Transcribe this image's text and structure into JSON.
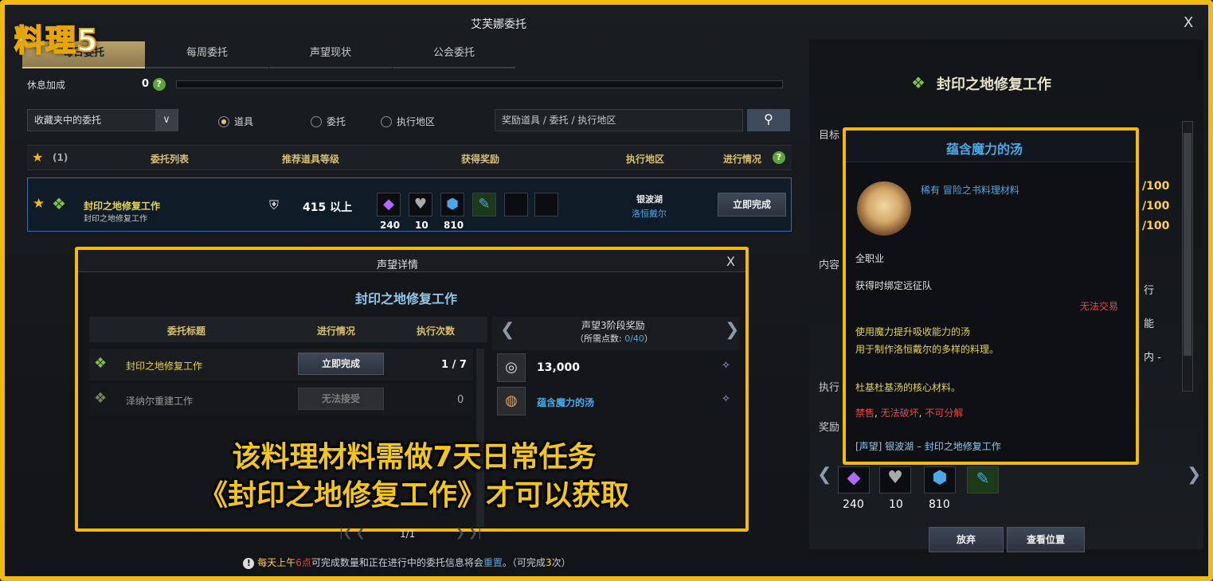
{
  "overlay_tag": "料理5",
  "window": {
    "title": "艾芙娜委托",
    "close_glyph": "X"
  },
  "tabs": [
    {
      "label": "每日委托",
      "active": true
    },
    {
      "label": "每周委托",
      "active": false
    },
    {
      "label": "声望现状",
      "active": false
    },
    {
      "label": "公会委托",
      "active": false
    }
  ],
  "rest": {
    "label": "休息加成",
    "value": "0",
    "help": "?"
  },
  "filter": {
    "dropdown_value": "收藏夹中的委托",
    "radio_item": "道具",
    "radio_task": "委托",
    "radio_area": "执行地区",
    "search_placeholder": "奖励道具 / 委托 / 执行地区"
  },
  "table_header": {
    "fav_count": "(1)",
    "list": "委托列表",
    "level": "推荐道具等级",
    "reward": "获得奖励",
    "area": "执行地区",
    "progress": "进行情况",
    "help": "?"
  },
  "quest_row": {
    "name": "封印之地修复工作",
    "sub": "封印之地修复工作",
    "level": "415 以上",
    "rewards": [
      {
        "icon": "amethyst-icon",
        "count": "240"
      },
      {
        "icon": "heart-crystal-icon",
        "count": "10"
      },
      {
        "icon": "blue-crystal-icon",
        "count": "810"
      },
      {
        "icon": "potion-icon",
        "count": ""
      }
    ],
    "area_1": "银波湖",
    "area_2": "洛恒戴尔",
    "button": "立即完成"
  },
  "rep_popup": {
    "title": "声望详情",
    "subtitle": "封印之地修复工作",
    "col_title": "委托标题",
    "col_progress": "进行情况",
    "col_count": "执行次数",
    "rows": [
      {
        "name": "封印之地修复工作",
        "button": "立即完成",
        "count": "1 / 7"
      },
      {
        "name": "泽纳尔重建工作",
        "button": "无法接受",
        "count": "0"
      }
    ],
    "reward_title": "声望3阶段奖励",
    "reward_need_prefix": "（所需点数: ",
    "reward_need_value": "0/40",
    "reward_need_suffix": "）",
    "reward_items": [
      {
        "label": "13,000",
        "icon": "silver-coin-icon"
      },
      {
        "label": "蕴含魔力的汤",
        "icon": "soup-bowl-icon"
      }
    ],
    "close_glyph": "X"
  },
  "overlay_text": {
    "line1": "该料理材料需做7天日常任务",
    "line2": "《封印之地修复工作》才可以获取"
  },
  "pager": {
    "text": "1/1"
  },
  "info_bar": {
    "icon": "info-icon",
    "p1": "每天上午",
    "p2": "6点",
    "p3": "可完成数量和正在进行中的委托信息将会",
    "p4": "重置",
    "p5": "。（可完成",
    "p6": "3",
    "p7": "次）"
  },
  "right_panel": {
    "title": "封印之地修复工作",
    "target_label": "目标",
    "content_label": "内容",
    "exec_label": "执行",
    "reward_label": "奖励",
    "progress_values": [
      "/100",
      "/100",
      "/100"
    ],
    "side_text_1": "行",
    "side_text_2": "能",
    "side_text_3": "内 -",
    "rewards": [
      {
        "icon": "amethyst-icon",
        "count": "240"
      },
      {
        "icon": "heart-crystal-icon",
        "count": "10"
      },
      {
        "icon": "blue-crystal-icon",
        "count": "810"
      },
      {
        "icon": "potion-icon",
        "count": ""
      }
    ],
    "btn_abandon": "放弃",
    "btn_location": "查看位置"
  },
  "tooltip": {
    "title": "蕴含魔力的汤",
    "grade": "稀有 冒险之书料理材料",
    "class": "全职业",
    "bind": "获得时绑定远征队",
    "trade": "无法交易",
    "desc1": "使用魔力提升吸收能力的汤",
    "desc2": "用于制作洛恒戴尔的多样的料理。",
    "core": "杜基杜基汤的核心材料。",
    "flags_1": "禁售",
    "flags_sep": ", ",
    "flags_2": "无法破坏",
    "flags_sep2": ", ",
    "flags_3": "不可分解",
    "source": "[声望] 银波湖 – 封印之地修复工作"
  },
  "colors": {
    "highlight": "#f2b90f",
    "accent_green": "#9bd45a",
    "accent_blue": "#4aa8e8",
    "warn_red": "#e24848"
  }
}
